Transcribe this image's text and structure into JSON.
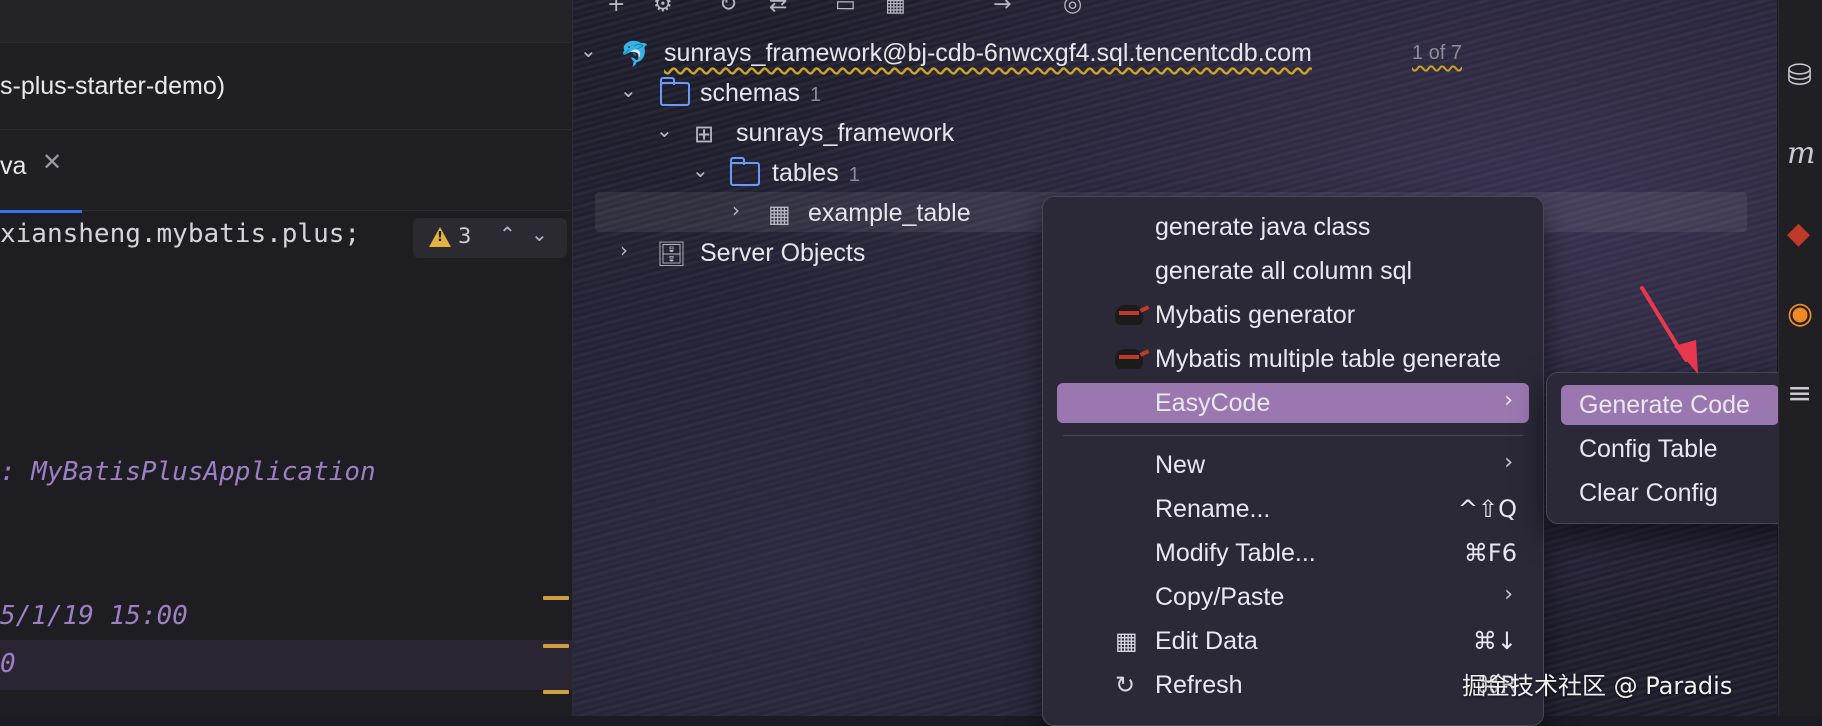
{
  "editor": {
    "project_label": "s-plus-starter-demo)",
    "tab_label": "va",
    "tab_close": "✕",
    "code_package": "xiansheng.mybatis.plus;",
    "code_app": ": MyBatisPlusApplication",
    "code_date": "5/1/19 15:00",
    "code_zero": "0",
    "inspection": {
      "count": "3",
      "up": "⌃",
      "down": "⌄"
    }
  },
  "tree": {
    "connection": {
      "label": "sunrays_framework@bj-cdb-6nwcxgf4.sql.tencentcdb.com",
      "count": "1 of 7"
    },
    "schemas": {
      "label": "schemas",
      "count": "1"
    },
    "schema": {
      "label": "sunrays_framework"
    },
    "tables": {
      "label": "tables",
      "count": "1"
    },
    "table": {
      "label": "example_table"
    },
    "server_objects": {
      "label": "Server Objects"
    }
  },
  "context_menu": {
    "items": [
      {
        "label": "generate java class"
      },
      {
        "label": "generate all column sql"
      },
      {
        "label": "Mybatis generator"
      },
      {
        "label": "Mybatis multiple table generate"
      },
      {
        "label": "EasyCode",
        "arrow": "›"
      },
      {
        "label": "New",
        "arrow": "›"
      },
      {
        "label": "Rename...",
        "shortcut": "^⇧Q"
      },
      {
        "label": "Modify Table...",
        "shortcut": "⌘F6"
      },
      {
        "label": "Copy/Paste",
        "arrow": "›"
      },
      {
        "label": "Edit Data",
        "shortcut": "⌘↓"
      },
      {
        "label": "Refresh",
        "shortcut": "⌘R"
      }
    ]
  },
  "submenu": {
    "items": [
      {
        "label": "Generate Code"
      },
      {
        "label": "Config Table"
      },
      {
        "label": "Clear Config"
      }
    ]
  },
  "colors": {
    "highlight": "#9b77b0",
    "accent": "#3574f0",
    "annotation": "#e8384f"
  },
  "watermark": "掘金技术社区 @ Paradis"
}
